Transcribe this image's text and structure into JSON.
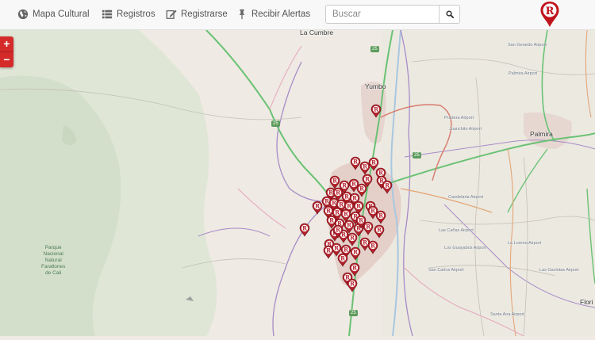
{
  "navbar": {
    "items": [
      {
        "label": "Mapa Cultural",
        "icon": "globe-icon"
      },
      {
        "label": "Registros",
        "icon": "list-icon"
      },
      {
        "label": "Registrarse",
        "icon": "edit-icon"
      },
      {
        "label": "Recibir Alertas",
        "icon": "pin-icon"
      }
    ],
    "search": {
      "placeholder": "Buscar",
      "icon": "search-icon"
    },
    "logo": {
      "letter": "R",
      "color": "#c0141d"
    }
  },
  "zoom": {
    "in_label": "+",
    "out_label": "−",
    "color": "#d42a2a"
  },
  "map": {
    "places": [
      {
        "name": "La Cumbre",
        "small": false
      },
      {
        "name": "Yumbo",
        "small": false
      },
      {
        "name": "Palmira",
        "small": false
      },
      {
        "name": "Flori",
        "small": false
      },
      {
        "name": "San Gerardo Airport",
        "small": true
      },
      {
        "name": "Palmira Airport",
        "small": true
      },
      {
        "name": "Pradera Airport",
        "small": true
      },
      {
        "name": "Juanchito Airport",
        "small": true
      },
      {
        "name": "Candelaria Airport",
        "small": true
      },
      {
        "name": "Las Cañas Airport",
        "small": true
      },
      {
        "name": "La Lorena Airport",
        "small": true
      },
      {
        "name": "Los Guayabos Airport",
        "small": true
      },
      {
        "name": "San Carlos Airport",
        "small": true
      },
      {
        "name": "Las Gaviotas Airport",
        "small": true
      },
      {
        "name": "Santa Ana Airport",
        "small": true
      }
    ],
    "park_label": "Parque\nNacional\nNatural\nFarallones\nde Cali",
    "route_shields": [
      "25",
      "25",
      "25",
      "25"
    ],
    "marker_letter": "R",
    "marker_color": "#b3202a",
    "marker_count": 52
  }
}
